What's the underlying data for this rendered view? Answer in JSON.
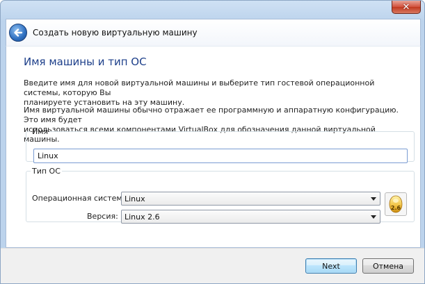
{
  "window": {
    "close_glyph": "✕",
    "title": "Создать новую виртуальную машину"
  },
  "page": {
    "heading": "Имя машины и тип ОС",
    "intro_line1": "Введите имя для новой виртуальной машины и выберите тип гостевой операционной системы, которую Вы",
    "intro_line2": "планируете установить на эту машину.",
    "info_line1": "Имя виртуальной машины обычно отражает ее программную и аппаратную конфигурацию. Это имя будет",
    "info_line2": "использоваться всеми компонентами VirtualBox для обозначения данной виртуальной машины."
  },
  "name_group": {
    "legend": "Имя",
    "value": "Linux"
  },
  "os_group": {
    "legend": "Тип ОС",
    "os_label": "Операционная система:",
    "os_value": "Linux",
    "version_label": "Версия:",
    "version_value": "Linux 2.6",
    "icon_text": "2.6",
    "icon_name": "linux-os-icon"
  },
  "footer": {
    "next_label": "Next",
    "cancel_label": "Отмена"
  }
}
